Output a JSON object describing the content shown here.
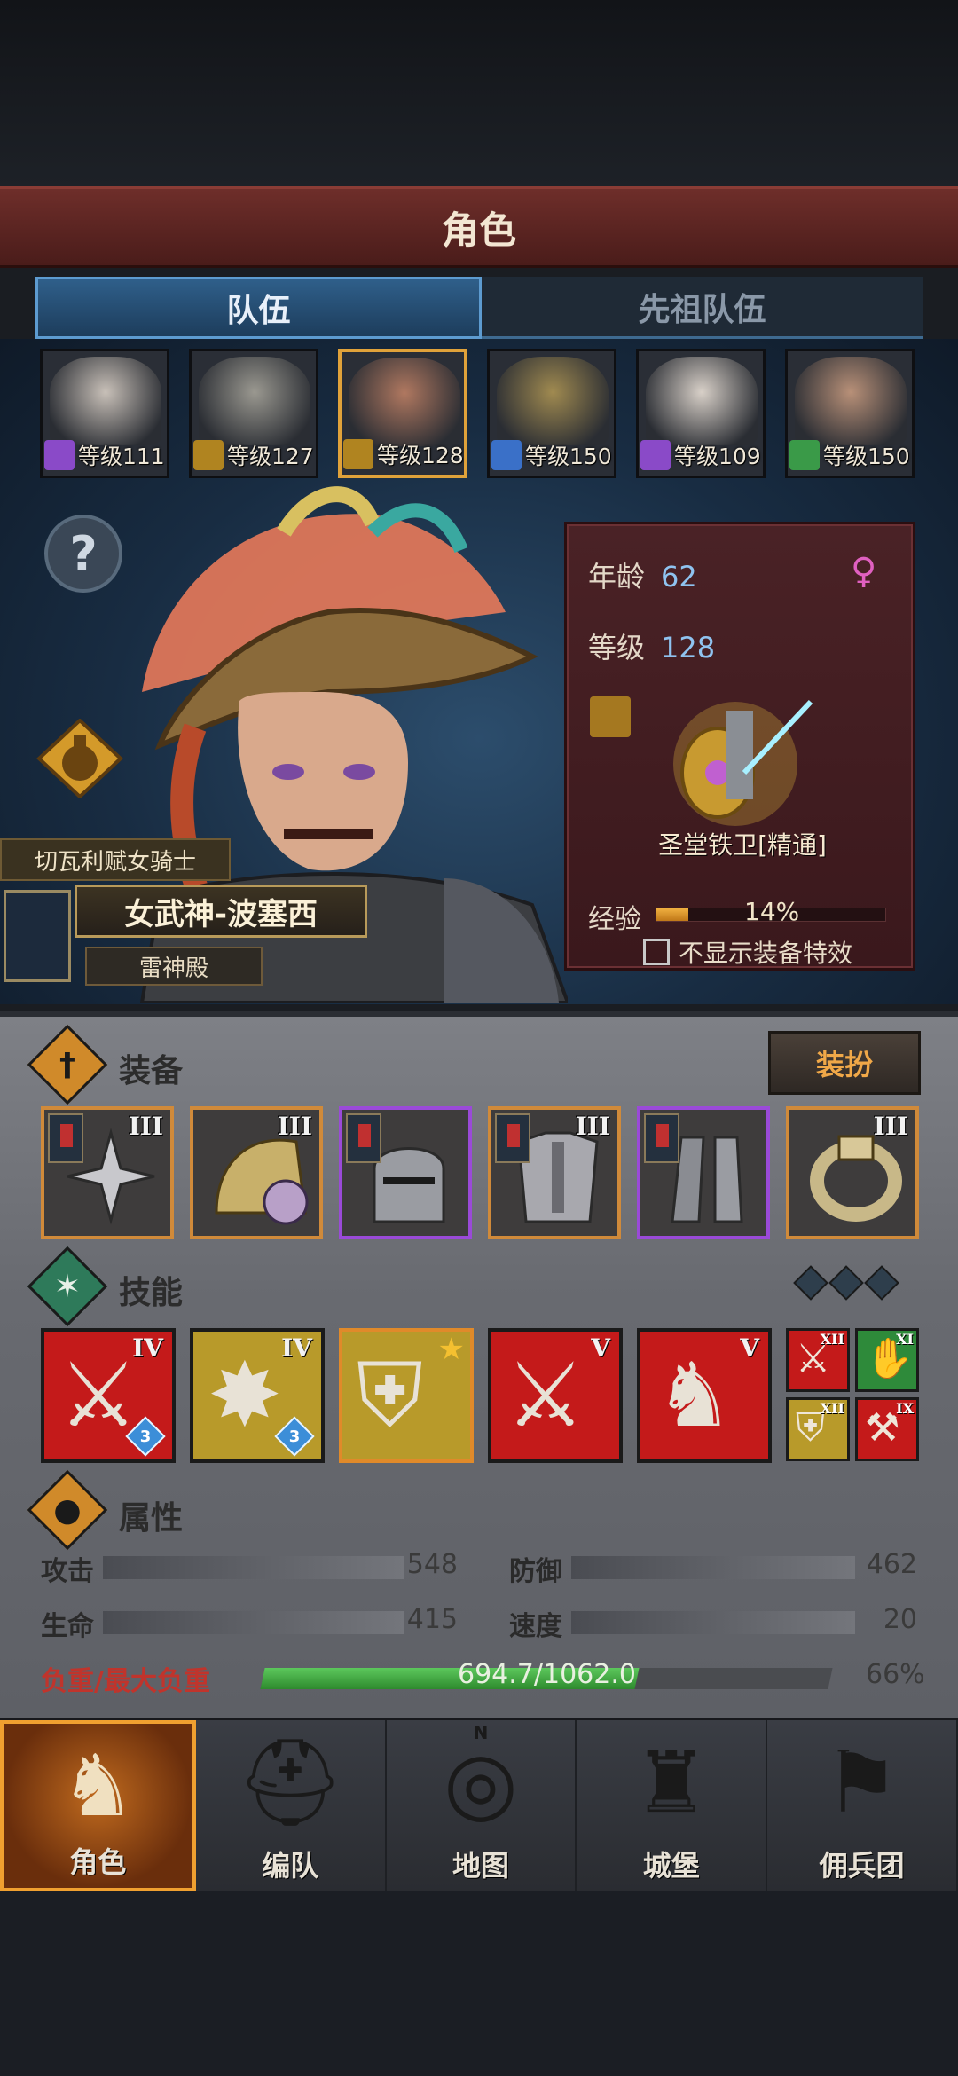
{
  "header": {
    "title": "角色"
  },
  "tabs": [
    {
      "label": "队伍",
      "active": true
    },
    {
      "label": "先祖队伍",
      "active": false
    }
  ],
  "roster": [
    {
      "level": "等级111",
      "class_color": "#8a4ac8",
      "face": "#c8c0b8",
      "selected": false
    },
    {
      "level": "等级127",
      "class_color": "#b08420",
      "face": "#9a9890",
      "selected": false
    },
    {
      "level": "等级128",
      "class_color": "#b08420",
      "face": "#b07860",
      "selected": true
    },
    {
      "level": "等级150",
      "class_color": "#3a70c8",
      "face": "#a08a50",
      "selected": false
    },
    {
      "level": "等级109",
      "class_color": "#8a4ac8",
      "face": "#d8d0c8",
      "selected": false
    },
    {
      "level": "等级150",
      "class_color": "#3a9a48",
      "face": "#b89078",
      "selected": false
    }
  ],
  "hero": {
    "subtitle": "切瓦利赋女骑士",
    "name": "女武神-波塞西",
    "temple": "雷神殿"
  },
  "info": {
    "age_label": "年龄",
    "age": "62",
    "level_label": "等级",
    "level": "128",
    "class_name": "圣堂铁卫[精通]",
    "exp_label": "经验",
    "exp_pct_text": "14%",
    "exp_fraction": 0.14,
    "hide_effects_label": "不显示装备特效"
  },
  "equipment_section": {
    "title": "装备",
    "dress_button": "装扮",
    "items": [
      {
        "name": "cross-shuriken",
        "tier": "III",
        "rarity": "orange",
        "banner": true
      },
      {
        "name": "gold-shoulder-armor",
        "tier": "III",
        "rarity": "orange",
        "banner": false
      },
      {
        "name": "knight-helmet",
        "tier": "",
        "rarity": "purple",
        "banner": true
      },
      {
        "name": "plate-armor",
        "tier": "III",
        "rarity": "orange",
        "banner": true
      },
      {
        "name": "greaves",
        "tier": "",
        "rarity": "purple",
        "banner": true
      },
      {
        "name": "ring",
        "tier": "III",
        "rarity": "orange",
        "banner": false
      }
    ]
  },
  "skills_section": {
    "title": "技能",
    "skills": [
      {
        "tier": "IV",
        "color": "red",
        "glyph": "⚔",
        "badge": "3"
      },
      {
        "tier": "IV",
        "color": "gold",
        "glyph": "✸",
        "badge": "3"
      },
      {
        "tier": "",
        "color": "gold",
        "glyph": "⛨",
        "badge": "",
        "star": "★"
      },
      {
        "tier": "V",
        "color": "red",
        "glyph": "⚔",
        "badge": ""
      },
      {
        "tier": "V",
        "color": "red",
        "glyph": "♞",
        "badge": ""
      }
    ],
    "mini_skills": [
      {
        "tier": "XII",
        "color": "#c41a1a",
        "glyph": "⚔"
      },
      {
        "tier": "XI",
        "color": "#2e8a3a",
        "glyph": "✋"
      },
      {
        "tier": "XII",
        "color": "#b89a2a",
        "glyph": "⛨"
      },
      {
        "tier": "IX",
        "color": "#c41a1a",
        "glyph": "⚒"
      }
    ]
  },
  "attributes_section": {
    "title": "属性",
    "attack_label": "攻击",
    "attack": "548",
    "defense_label": "防御",
    "defense": "462",
    "hp_label": "生命",
    "hp": "415",
    "speed_label": "速度",
    "speed": "20",
    "load_label": "负重/最大负重",
    "load_value": "694.7/1062.0",
    "load_pct": "66%",
    "load_fraction": 0.66
  },
  "nav": [
    {
      "label": "角色",
      "icon": "knight-icon",
      "active": true
    },
    {
      "label": "编队",
      "icon": "helmet-icon",
      "active": false
    },
    {
      "label": "地图",
      "icon": "compass-map-icon",
      "active": false,
      "mark": "N"
    },
    {
      "label": "城堡",
      "icon": "castle-icon",
      "active": false
    },
    {
      "label": "佣兵团",
      "icon": "mercenary-icon",
      "active": false
    }
  ],
  "colors": {
    "accent_orange": "#e0a23a",
    "tab_blue": "#2f5f8a",
    "title_red": "#6e2e2a",
    "load_green": "#4ab84a"
  }
}
